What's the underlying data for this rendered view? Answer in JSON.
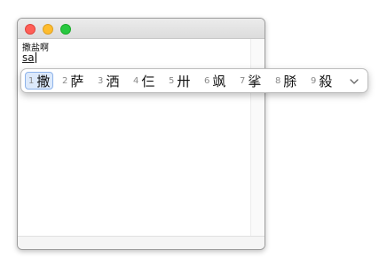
{
  "window": {
    "controls": [
      "close",
      "minimize",
      "zoom"
    ]
  },
  "editor": {
    "line1": "撒盐啊",
    "composing": "sa"
  },
  "candidates": {
    "items": [
      {
        "num": "1",
        "char": "撒",
        "selected": true
      },
      {
        "num": "2",
        "char": "萨",
        "selected": false
      },
      {
        "num": "3",
        "char": "洒",
        "selected": false
      },
      {
        "num": "4",
        "char": "仨",
        "selected": false
      },
      {
        "num": "5",
        "char": "卅",
        "selected": false
      },
      {
        "num": "6",
        "char": "飒",
        "selected": false
      },
      {
        "num": "7",
        "char": "挲",
        "selected": false
      },
      {
        "num": "8",
        "char": "脎",
        "selected": false
      },
      {
        "num": "9",
        "char": "殺",
        "selected": false
      }
    ],
    "expand_icon": "chevron-down-icon"
  },
  "colors": {
    "close": "#ff5f57",
    "minimize": "#febc2e",
    "zoom": "#28c840",
    "selection": "#dce9fb"
  }
}
